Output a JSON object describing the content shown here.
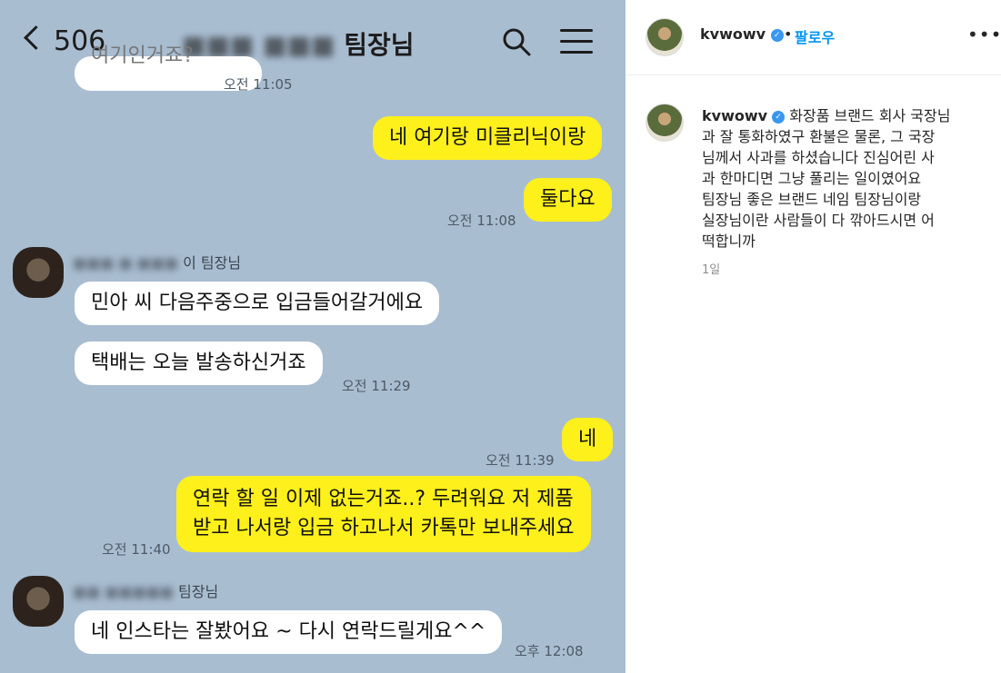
{
  "chat": {
    "back_count": "506",
    "title": "팀장님",
    "messages": [
      {
        "text": "여기인거죠?",
        "time": "오전 11:05"
      },
      {
        "text": "네 여기랑 미클리닉이랑"
      },
      {
        "text": "둘다요",
        "time": "오전 11:08"
      },
      {
        "sender": "이 팀장님"
      },
      {
        "text": "민아 씨 다음주중으로 입금들어갈거에요"
      },
      {
        "text": "택배는 오늘 발송하신거죠",
        "time": "오전 11:29"
      },
      {
        "text": "네",
        "time": "오전 11:39"
      },
      {
        "text_line1": "연락 할 일 이제 없는거죠..? 두려워요 저 제품",
        "text_line2": "받고 나서랑 입금 하고나서 카톡만 보내주세요",
        "time": "오전 11:40"
      },
      {
        "sender": "팀장님"
      },
      {
        "text": "네 인스타는 잘봤어요 ~ 다시 연락드릴게요^^",
        "time": "오후 12:08"
      }
    ]
  },
  "instagram": {
    "username": "kvwowv",
    "follow_label": "팔로우",
    "caption_lines": [
      "화장품 브랜드 회사 국장님",
      "과 잘 통화하였구 환불은 물론, 그 국장",
      "님께서 사과를 하셨습니다 진심어린 사",
      "과 한마디면 그냥 풀리는 일이였어요",
      "팀장님 좋은 브랜드 네임 팀장님이랑",
      "실장님이란 사람들이 다 깎아드시면 어",
      "떡합니까"
    ],
    "age": "1일",
    "more": "•••",
    "dot": "•"
  },
  "colors": {
    "chat_bg": "#a9bdd1",
    "yellow_bubble": "#fef01b",
    "follow_blue": "#0095f6",
    "verified_blue": "#3897f0"
  }
}
